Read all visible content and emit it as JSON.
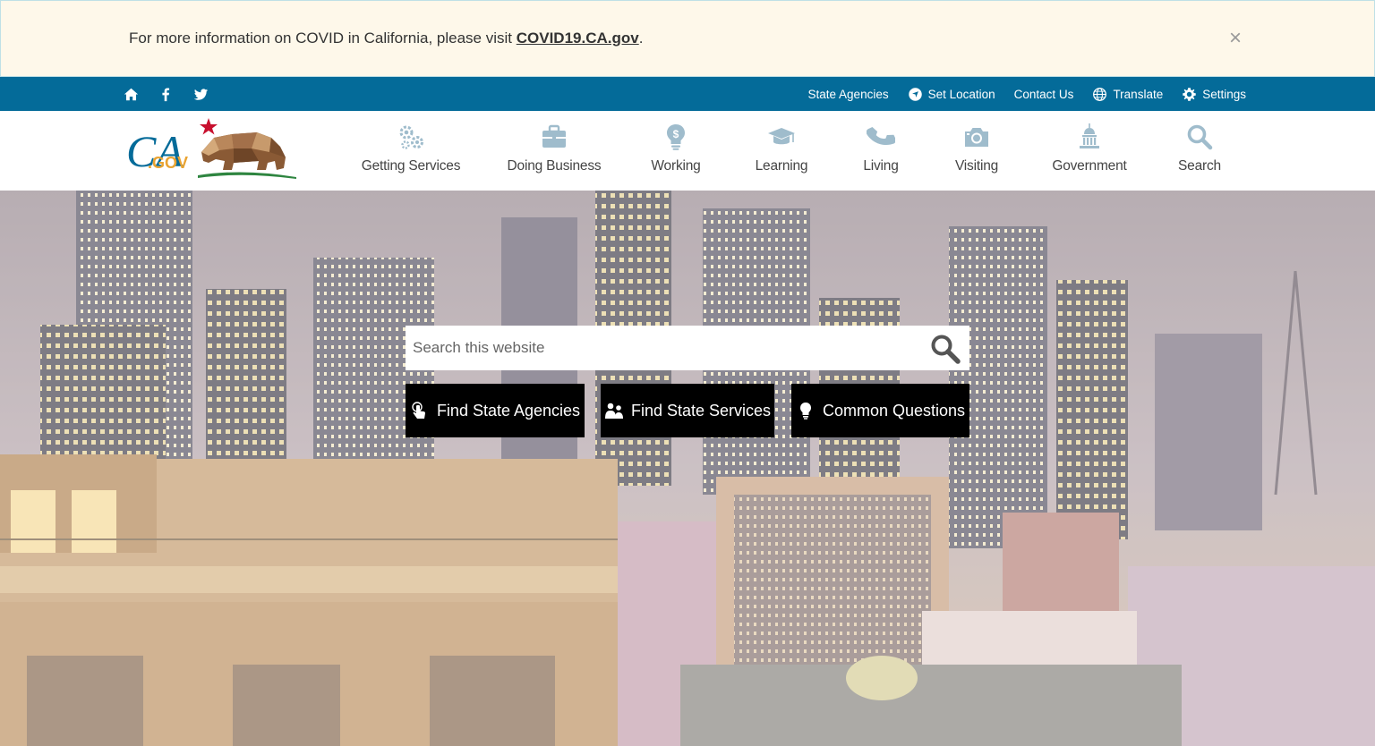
{
  "alert": {
    "text": "For more information on COVID in California, please visit ",
    "link": "COVID19.CA.gov",
    "after": ".",
    "close": "×"
  },
  "utility": {
    "social": [
      "home-icon",
      "facebook-icon",
      "twitter-icon"
    ],
    "links": {
      "state_agencies": "State Agencies",
      "set_location": "Set Location",
      "contact_us": "Contact Us",
      "translate": "Translate",
      "settings": "Settings"
    }
  },
  "logo": {
    "text": "CA",
    "sub": ".GOV"
  },
  "nav": {
    "getting_services": "Getting Services",
    "doing_business": "Doing Business",
    "working": "Working",
    "learning": "Learning",
    "living": "Living",
    "visiting": "Visiting",
    "government": "Government",
    "search": "Search"
  },
  "hero": {
    "search_placeholder": "Search this website",
    "buttons": {
      "agencies": "Find State Agencies",
      "services": "Find State Services",
      "questions": "Common Questions"
    }
  },
  "colors": {
    "utility_bar": "#046b99",
    "alert_bg": "#fef8ea",
    "nav_icon": "#9fbccc",
    "button_bg": "#000000"
  }
}
